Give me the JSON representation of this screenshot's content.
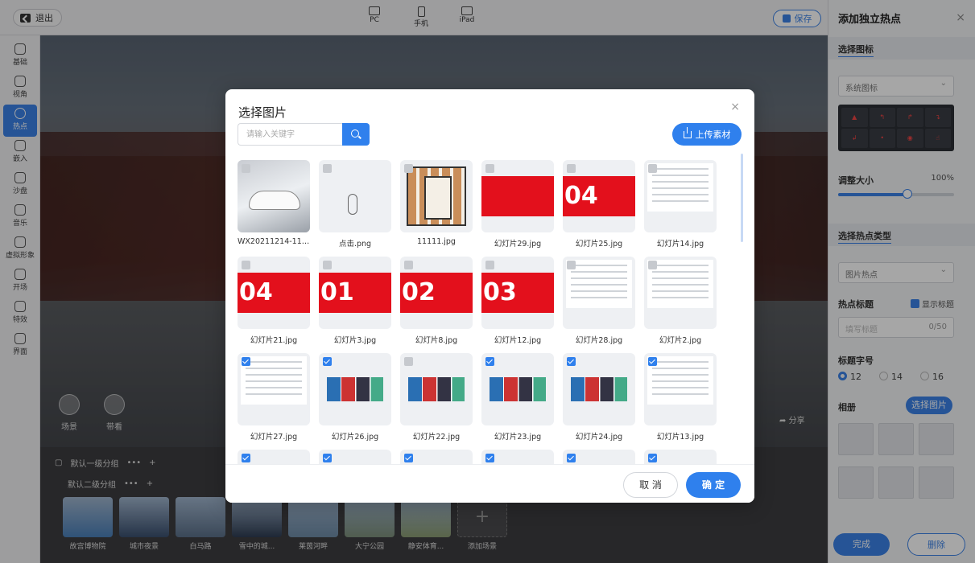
{
  "topbar": {
    "exit_label": "退出",
    "devices": [
      {
        "label": "PC",
        "icon": "monitor-icon"
      },
      {
        "label": "手机",
        "icon": "phone-icon"
      },
      {
        "label": "iPad",
        "icon": "tablet-icon"
      }
    ],
    "save_label": "保存"
  },
  "sidebar": {
    "items": [
      {
        "label": "基础",
        "icon": "layers-icon"
      },
      {
        "label": "视角",
        "icon": "viewpoint-icon"
      },
      {
        "label": "热点",
        "icon": "hotspot-icon",
        "active": true
      },
      {
        "label": "嵌入",
        "icon": "embed-icon"
      },
      {
        "label": "沙盘",
        "icon": "sandbox-icon"
      },
      {
        "label": "音乐",
        "icon": "music-icon"
      },
      {
        "label": "虚拟形象",
        "icon": "avatar-icon"
      },
      {
        "label": "开场",
        "icon": "opening-icon"
      },
      {
        "label": "特效",
        "icon": "effects-icon"
      },
      {
        "label": "界面",
        "icon": "layout-icon"
      }
    ]
  },
  "stage": {
    "buttons": [
      "场景",
      "带看"
    ],
    "share_label": "分享"
  },
  "bottom": {
    "group1_label": "默认一级分组",
    "group2_label": "默认二级分组",
    "more": "•••",
    "add": "+",
    "scenes": [
      "故宫博物院",
      "城市夜景",
      "白马路",
      "雪中的城...",
      "莱茵河畔",
      "大宁公园",
      "静安体育..."
    ],
    "add_scene_label": "添加场景"
  },
  "right_panel": {
    "title": "添加独立热点",
    "close": "×",
    "section_icon": "选择图标",
    "icon_select": "系统图标",
    "size_label": "调整大小",
    "size_value": "100%",
    "size_fraction": 0.6,
    "section_type": "选择热点类型",
    "type_select": "图片热点",
    "hotspot_title_label": "热点标题",
    "show_title_label": "显示标题",
    "title_placeholder": "填写标题",
    "title_count": "0/50",
    "font_size_label": "标题字号",
    "font_sizes": [
      "12",
      "14",
      "16"
    ],
    "font_size_selected": "12",
    "album_label": "相册",
    "pick_image_label": "选择图片",
    "done_label": "完成",
    "delete_label": "删除"
  },
  "modal": {
    "title": "选择图片",
    "close": "×",
    "search_placeholder": "请输入关键字",
    "upload_label": "上传素材",
    "files": [
      {
        "name": "WX20211214-113...",
        "checked": false,
        "kind": "car"
      },
      {
        "name": "点击.png",
        "checked": false,
        "kind": "hand"
      },
      {
        "name": "11111.jpg",
        "checked": false,
        "kind": "plan"
      },
      {
        "name": "幻灯片29.jpg",
        "checked": false,
        "kind": "red"
      },
      {
        "name": "幻灯片25.jpg",
        "checked": false,
        "kind": "red",
        "big": "04"
      },
      {
        "name": "幻灯片14.jpg",
        "checked": false,
        "kind": "doc"
      },
      {
        "name": "幻灯片21.jpg",
        "checked": false,
        "kind": "red",
        "big": "04"
      },
      {
        "name": "幻灯片3.jpg",
        "checked": false,
        "kind": "red",
        "big": "01"
      },
      {
        "name": "幻灯片8.jpg",
        "checked": false,
        "kind": "red",
        "big": "02"
      },
      {
        "name": "幻灯片12.jpg",
        "checked": false,
        "kind": "red",
        "big": "03"
      },
      {
        "name": "幻灯片28.jpg",
        "checked": false,
        "kind": "doc"
      },
      {
        "name": "幻灯片2.jpg",
        "checked": false,
        "kind": "doc"
      },
      {
        "name": "幻灯片27.jpg",
        "checked": true,
        "kind": "doc"
      },
      {
        "name": "幻灯片26.jpg",
        "checked": true,
        "kind": "shots"
      },
      {
        "name": "幻灯片22.jpg",
        "checked": false,
        "kind": "shots"
      },
      {
        "name": "幻灯片23.jpg",
        "checked": true,
        "kind": "shots"
      },
      {
        "name": "幻灯片24.jpg",
        "checked": true,
        "kind": "shots"
      },
      {
        "name": "幻灯片13.jpg",
        "checked": true,
        "kind": "doc"
      }
    ],
    "cancel_label": "取 消",
    "ok_label": "确 定"
  },
  "colors": {
    "accent": "#2f80ed",
    "slide_red": "#e3101c"
  }
}
